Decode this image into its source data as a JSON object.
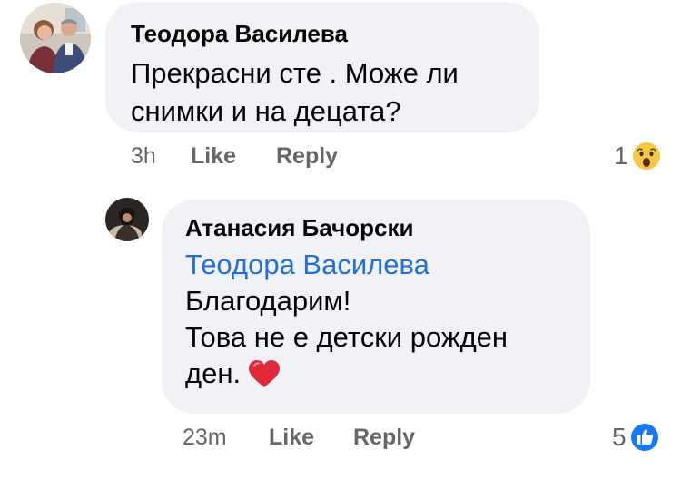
{
  "comment": {
    "author": "Теодора Василева",
    "text_line1": "Прекрасни сте . Може ли",
    "text_line2": "снимки и на децата?",
    "time": "3h",
    "like_label": "Like",
    "reply_label": "Reply",
    "reaction_count": "1",
    "reaction_icon": "wow-reaction-icon"
  },
  "reply": {
    "author": "Атанасия Бачорски",
    "mention": "Теодора Василева",
    "text_line1": "Благодарим!",
    "text_line2": "Това не е детски рожден",
    "text_line3": "ден.",
    "emoji": "heart-icon",
    "time": "23m",
    "like_label": "Like",
    "reply_label": "Reply",
    "reaction_count": "5",
    "reaction_icon": "like-reaction-icon"
  },
  "colors": {
    "bubble": "#f0f2f5",
    "mention": "#216fdb",
    "secondary_text": "#65676b",
    "like_blue": "#1877f2",
    "heart_red": "#e02a3a"
  }
}
